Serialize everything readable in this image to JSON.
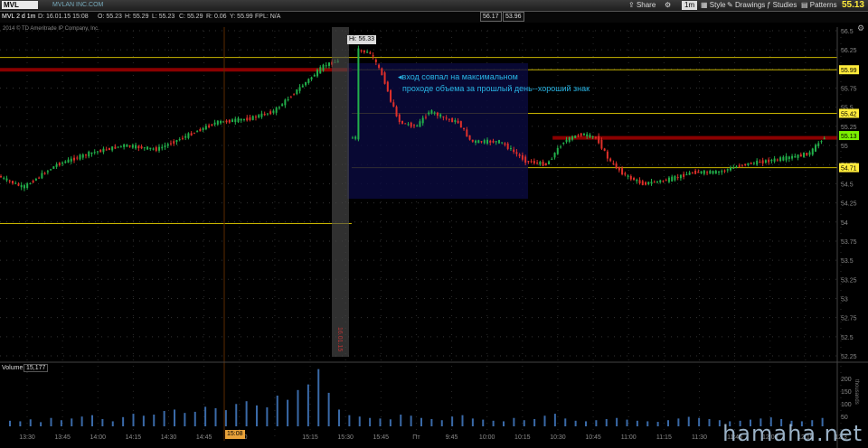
{
  "toolbar": {
    "symbol": "MVL",
    "company": "MVLAN INC.COM",
    "share_label": "Share",
    "timeframe": "1m",
    "style_label": "Style",
    "drawings_label": "Drawings",
    "studies_label": "Studies",
    "patterns_label": "Patterns",
    "last_price": "55.13"
  },
  "quote": {
    "chart_label": "MVL 2 d 1m",
    "date": "D: 16.01.15 15:08",
    "open": "O: 55.23",
    "high": "H: 55.29",
    "low": "L: 55.23",
    "close": "C: 55.29",
    "range": "R: 0.06",
    "ytd": "Y: 55.99",
    "fpl": "FPL: N/A",
    "bid": "56.17",
    "ask": "53.96",
    "copyright": "2014 © TD Ameritrade IP Company, Inc."
  },
  "annotation": {
    "line1": "вход совпал на максимальном",
    "line2": "проходе объема за прошлый день--хороший знак",
    "hi_label": "Hi: 56.33",
    "cursor_time": "15:08",
    "day_marker": "Пт"
  },
  "volume": {
    "label": "Volume",
    "value": "15,177",
    "unit": "thousands",
    "ticks": [
      "200",
      "150",
      "100",
      "50"
    ]
  },
  "watermark": "hamaha.net",
  "colors": {
    "up": "#22b04b",
    "down": "#e0302a",
    "level": "#c8b400",
    "resist": "#8a0000",
    "highlight": "#ffeb3b"
  },
  "chart_data": {
    "type": "candlestick",
    "ylim": [
      52.25,
      56.5
    ],
    "yticks": [
      "56.5",
      "56.25",
      "56",
      "55.75",
      "55.5",
      "55.25",
      "55",
      "54.75",
      "54.5",
      "54.25",
      "54",
      "53.75",
      "53.5",
      "53.25",
      "53",
      "52.75",
      "52.5",
      "52.25"
    ],
    "xticks": [
      "13:30",
      "13:45",
      "14:00",
      "14:15",
      "14:30",
      "14:45",
      "15:00",
      "15:08",
      "15:15",
      "15:30",
      "15:45",
      "Пт",
      "9:45",
      "10:00",
      "10:15",
      "10:30",
      "10:45",
      "11:00",
      "11:15",
      "11:30",
      "11:45",
      "12:00",
      "12:15",
      "12:3"
    ],
    "price_labels": [
      {
        "value": "55.99",
        "price": 55.99
      },
      {
        "value": "55.42",
        "price": 55.42
      },
      {
        "value": "55.13",
        "price": 55.13
      },
      {
        "value": "54.71",
        "price": 54.71
      }
    ],
    "levels": [
      {
        "price": 56.15,
        "color": "level",
        "from": 0,
        "to": 1
      },
      {
        "price": 55.99,
        "color": "resist",
        "from": 0,
        "to": 0.42
      },
      {
        "price": 55.99,
        "color": "level",
        "from": 0.42,
        "to": 1
      },
      {
        "price": 55.42,
        "color": "level",
        "from": 0.42,
        "to": 1
      },
      {
        "price": 55.1,
        "color": "resist",
        "from": 0.66,
        "to": 1
      },
      {
        "price": 54.71,
        "color": "level",
        "from": 0.42,
        "to": 1
      },
      {
        "price": 53.98,
        "color": "level",
        "from": 0,
        "to": 0.42
      }
    ],
    "day1_path": [
      [
        0,
        54.6
      ],
      [
        0.03,
        54.45
      ],
      [
        0.07,
        54.75
      ],
      [
        0.11,
        54.9
      ],
      [
        0.15,
        55
      ],
      [
        0.19,
        54.95
      ],
      [
        0.22,
        55.1
      ],
      [
        0.26,
        55.3
      ],
      [
        0.3,
        55.35
      ],
      [
        0.33,
        55.45
      ],
      [
        0.36,
        55.75
      ],
      [
        0.39,
        56.05
      ],
      [
        0.405,
        56.1
      ]
    ],
    "day2_path": [
      [
        0.43,
        56.25
      ],
      [
        0.445,
        56.2
      ],
      [
        0.46,
        55.9
      ],
      [
        0.47,
        55.55
      ],
      [
        0.48,
        55.3
      ],
      [
        0.5,
        55.25
      ],
      [
        0.515,
        55.45
      ],
      [
        0.535,
        55.35
      ],
      [
        0.55,
        55.3
      ],
      [
        0.565,
        55.05
      ],
      [
        0.6,
        55.05
      ],
      [
        0.63,
        54.8
      ],
      [
        0.655,
        54.75
      ],
      [
        0.675,
        55.05
      ],
      [
        0.695,
        55.15
      ],
      [
        0.715,
        55.1
      ],
      [
        0.73,
        54.8
      ],
      [
        0.75,
        54.6
      ],
      [
        0.77,
        54.5
      ],
      [
        0.8,
        54.55
      ],
      [
        0.83,
        54.65
      ],
      [
        0.86,
        54.65
      ],
      [
        0.89,
        54.75
      ],
      [
        0.92,
        54.8
      ],
      [
        0.95,
        54.85
      ],
      [
        0.97,
        54.9
      ],
      [
        0.985,
        55.1
      ]
    ],
    "volume": {
      "max": 220,
      "bars": [
        20,
        18,
        25,
        15,
        30,
        22,
        28,
        35,
        40,
        26,
        18,
        33,
        45,
        38,
        42,
        55,
        60,
        48,
        52,
        70,
        65,
        58,
        80,
        90,
        75,
        68,
        110,
        95,
        130,
        150,
        205,
        120,
        60,
        40,
        35,
        30,
        28,
        25,
        42,
        38,
        30,
        26,
        22,
        35,
        40,
        28,
        24,
        20,
        18,
        30,
        22,
        26,
        38,
        45,
        28,
        20,
        18,
        22,
        26,
        30,
        24,
        20,
        18,
        16,
        22,
        28,
        34,
        30,
        26,
        22,
        18,
        20,
        24,
        28,
        32,
        26,
        20,
        18,
        22,
        30
      ]
    }
  }
}
